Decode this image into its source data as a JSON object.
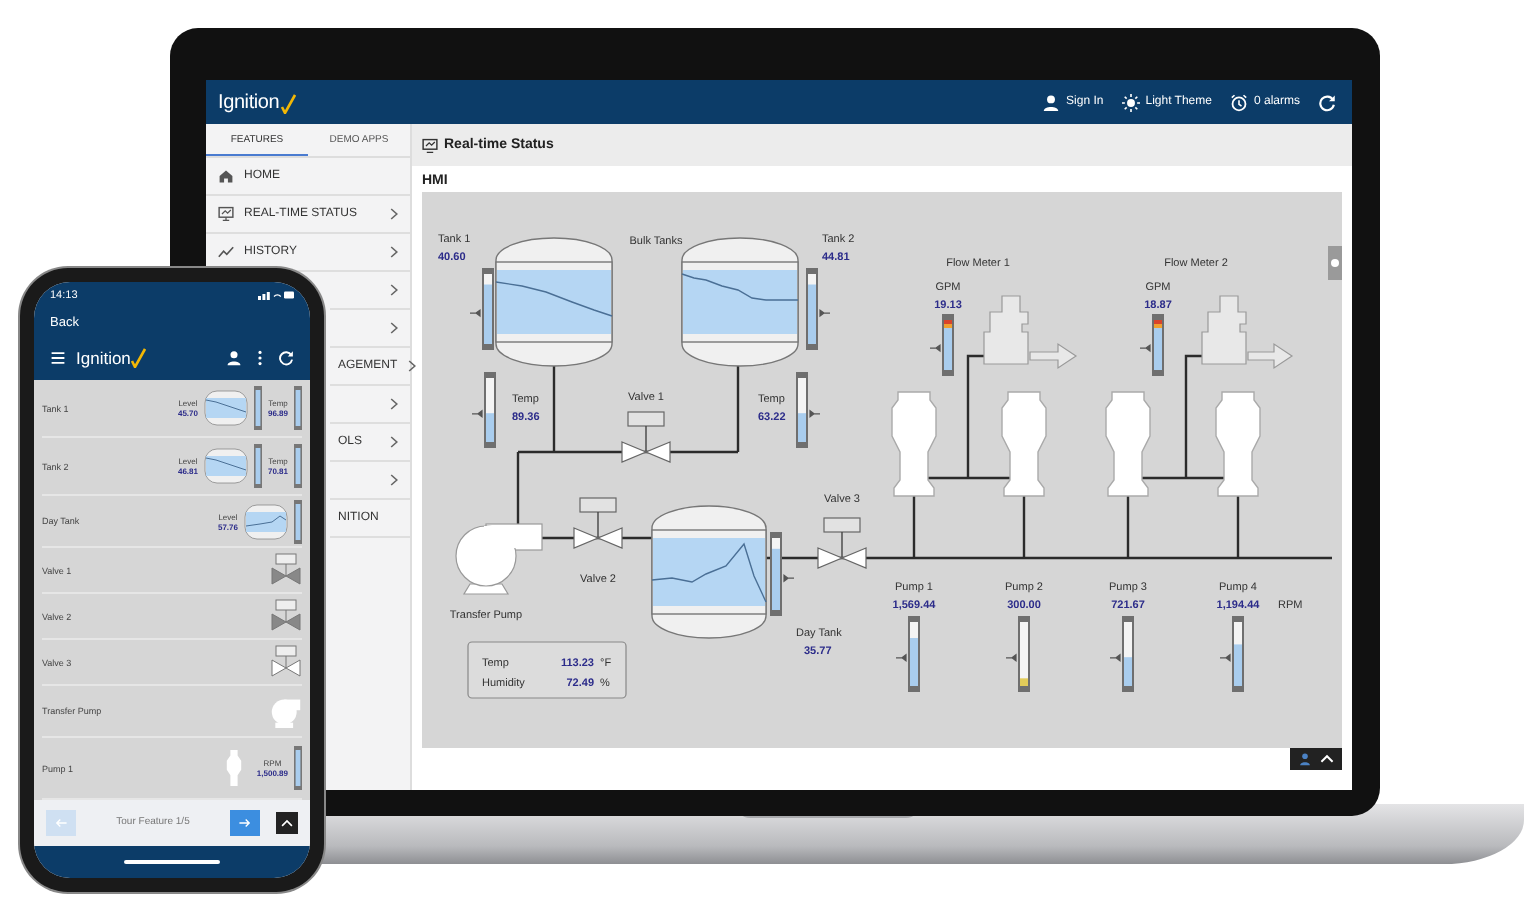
{
  "laptop": {
    "topbar": {
      "logo": "Ignition",
      "actions": [
        {
          "kind": "user",
          "label": "Sign In"
        },
        {
          "kind": "sun",
          "label": "Light Theme"
        },
        {
          "kind": "alarm",
          "label": "0 alarms"
        },
        {
          "kind": "refresh"
        }
      ]
    },
    "sidebar": {
      "tabs": [
        {
          "label": "FEATURES",
          "selected": true
        },
        {
          "label": "DEMO APPS",
          "selected": false
        }
      ],
      "items": [
        {
          "label": "HOME",
          "chevron": false
        },
        {
          "label": "REAL-TIME STATUS",
          "chevron": true
        },
        {
          "label": "HISTORY",
          "chevron": true
        },
        {
          "chevron": true
        },
        {
          "chevron": true
        },
        {
          "label": "AGEMENT",
          "chevron": true
        },
        {
          "chevron": true
        },
        {
          "label": "OLS",
          "chevron": true
        },
        {
          "chevron": true
        },
        {
          "label": "NITION",
          "chevron": false
        }
      ]
    },
    "page": {
      "title": "Real-time Status",
      "section": "HMI"
    },
    "hmi": {
      "title": "Bulk Tanks",
      "tanks": [
        {
          "label": "Tank 1",
          "value": "40.60",
          "level": 0.85
        },
        {
          "label": "Tank 2",
          "value": "44.81",
          "level": 0.85
        }
      ],
      "temps": [
        {
          "label": "Temp",
          "value": "89.36",
          "level": 0.45
        },
        {
          "label": "Temp",
          "value": "63.22",
          "level": 0.45
        }
      ],
      "valves": [
        "Valve 1",
        "Valve 2",
        "Valve 3"
      ],
      "flow_meters": [
        {
          "title": "Flow Meter 1",
          "unit": "GPM",
          "value": "19.13",
          "level": 0.9
        },
        {
          "title": "Flow Meter 2",
          "unit": "GPM",
          "value": "18.87",
          "level": 0.9
        }
      ],
      "transfer_pump": "Transfer Pump",
      "day_tank": {
        "label": "Day Tank",
        "value": "35.77",
        "level": 0.85
      },
      "pumps": [
        {
          "label": "Pump 1",
          "value": "1,569.44",
          "level": 0.75
        },
        {
          "label": "Pump 2",
          "value": "300.00",
          "level": 0.12
        },
        {
          "label": "Pump 3",
          "value": "721.67",
          "level": 0.45
        },
        {
          "label": "Pump 4",
          "value": "1,194.44",
          "level": 0.65
        }
      ],
      "pump_unit": "RPM",
      "environment": [
        {
          "label": "Temp",
          "value": "113.23",
          "unit": "°F"
        },
        {
          "label": "Humidity",
          "value": "72.49",
          "unit": "%"
        }
      ]
    }
  },
  "phone": {
    "time": "14:13",
    "back": "Back",
    "logo": "Ignition",
    "rows": [
      {
        "kind": "tank",
        "name": "Tank 1",
        "level_label": "Level",
        "level_value": "45.70",
        "temp_label": "Temp",
        "temp_value": "96.89"
      },
      {
        "kind": "tank",
        "name": "Tank 2",
        "level_label": "Level",
        "level_value": "46.81",
        "temp_label": "Temp",
        "temp_value": "70.81"
      },
      {
        "kind": "day_tank",
        "name": "Day Tank",
        "level_label": "Level",
        "level_value": "57.76"
      },
      {
        "kind": "valve",
        "name": "Valve 1",
        "open": false
      },
      {
        "kind": "valve",
        "name": "Valve 2",
        "open": false
      },
      {
        "kind": "valve",
        "name": "Valve 3",
        "open": true
      },
      {
        "kind": "transfer_pump",
        "name": "Transfer Pump"
      },
      {
        "kind": "pump",
        "name": "Pump 1",
        "unit": "RPM",
        "value": "1,500.89"
      }
    ],
    "tour": {
      "label": "Tour Feature 1/5",
      "prev_disabled": true
    }
  }
}
